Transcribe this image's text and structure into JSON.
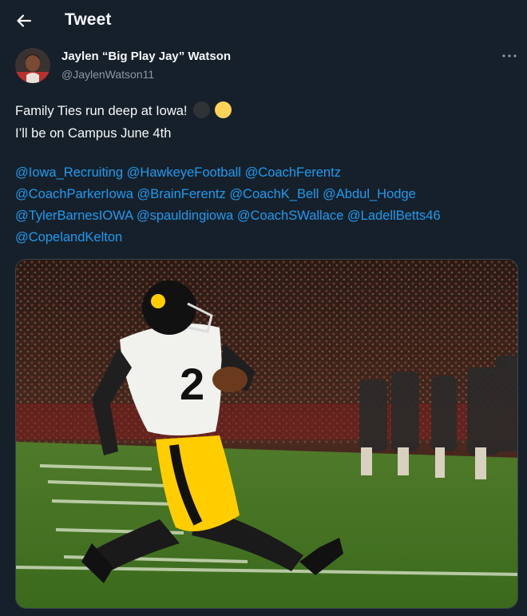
{
  "header": {
    "title": "Tweet",
    "back_icon": "back-arrow-icon"
  },
  "author": {
    "display_name": "Jaylen “Big Play Jay” Watson",
    "handle": "@JaylenWatson11"
  },
  "tweet": {
    "line1": "Family Ties run deep at Iowa!",
    "line2": "I’ll be on Campus June 4th",
    "emoji": [
      "black-circle",
      "yellow-circle"
    ],
    "mentions": [
      "@Iowa_Recruiting",
      "@HawkeyeFootball",
      "@CoachFerentz",
      "@CoachParkerIowa",
      "@BrainFerentz",
      "@CoachK_Bell",
      "@Abdul_Hodge",
      "@TylerBarnesIOWA",
      "@spauldingiowa",
      "@CoachSWallace",
      "@LadellBetts46",
      "@CopelandKelton"
    ],
    "media_alt": "Iowa football player running with the ball"
  },
  "colors": {
    "background": "#15202b",
    "link": "#1d9bf0",
    "text": "#f7f9f9",
    "secondary": "#8b98a5",
    "iowa_gold": "#ffcd00"
  }
}
